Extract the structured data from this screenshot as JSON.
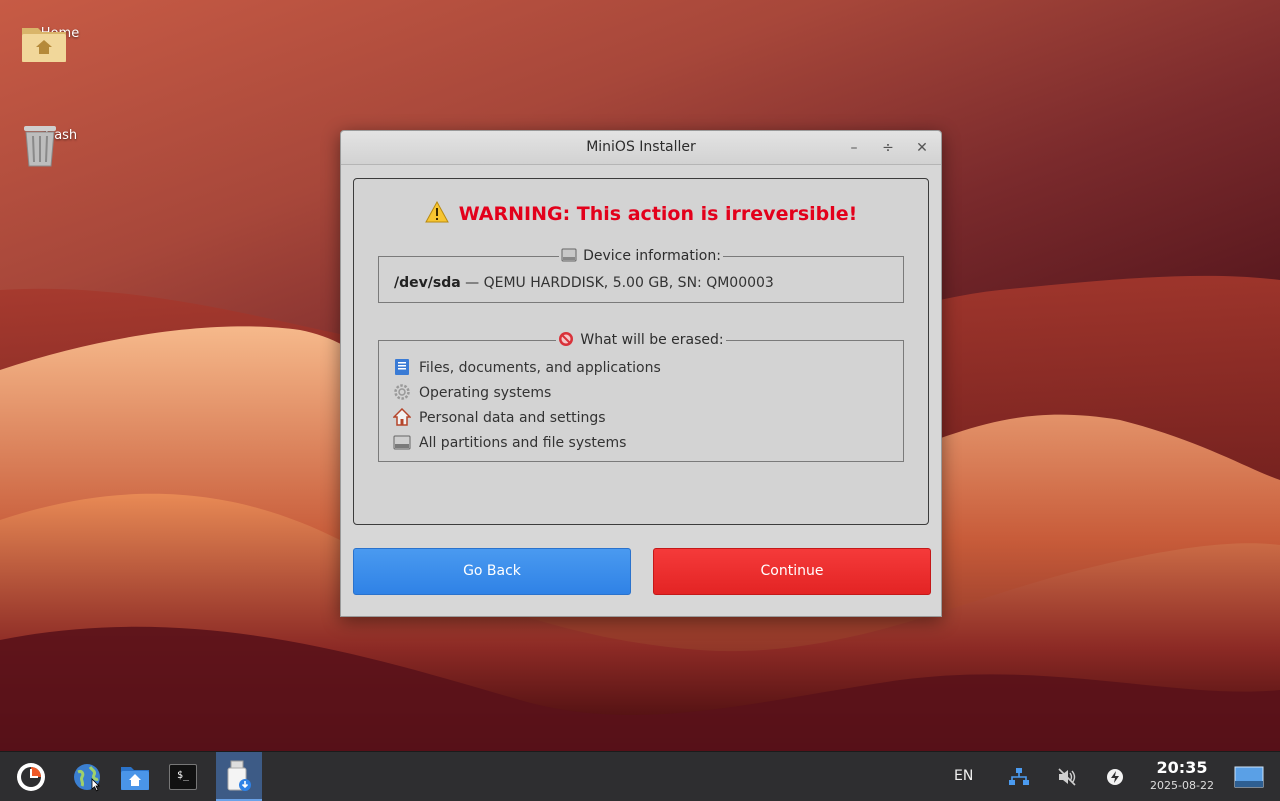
{
  "desktop": {
    "icons": [
      {
        "label": "Home",
        "icon": "home-folder-icon"
      },
      {
        "label": "Trash",
        "icon": "trash-icon"
      }
    ]
  },
  "window": {
    "title": "MiniOS Installer",
    "controls": {
      "minimize": "–",
      "maximize": "÷",
      "close": "✕"
    },
    "warning": "WARNING: This action is irreversible!",
    "device": {
      "group_title": "Device information:",
      "path": "/dev/sda",
      "details": " — QEMU HARDDISK, 5.00 GB, SN: QM00003"
    },
    "erase": {
      "group_title": "What will be erased:",
      "items": [
        {
          "label": "Files, documents, and applications",
          "icon": "document-icon"
        },
        {
          "label": "Operating systems",
          "icon": "gear-icon"
        },
        {
          "label": "Personal data and settings",
          "icon": "home-icon"
        },
        {
          "label": "All partitions and file systems",
          "icon": "drive-icon"
        }
      ]
    },
    "buttons": {
      "back": "Go Back",
      "continue": "Continue"
    },
    "colors": {
      "warning": "#e3001b",
      "back": "#3b8eea",
      "continue": "#eb2f2f"
    }
  },
  "taskbar": {
    "apps": [
      {
        "name": "start-menu",
        "icon": "start-icon"
      },
      {
        "name": "browser",
        "icon": "globe-icon"
      },
      {
        "name": "file-manager",
        "icon": "folder-home-icon"
      },
      {
        "name": "terminal",
        "icon": "terminal-icon",
        "glyph": "$_"
      },
      {
        "name": "installer",
        "icon": "usb-install-icon",
        "active": true
      }
    ],
    "tray": {
      "language": "EN",
      "network": "network-icon",
      "volume": "volume-muted-icon",
      "power": "power-icon"
    },
    "clock": {
      "time": "20:35",
      "date": "2025-08-22"
    }
  }
}
